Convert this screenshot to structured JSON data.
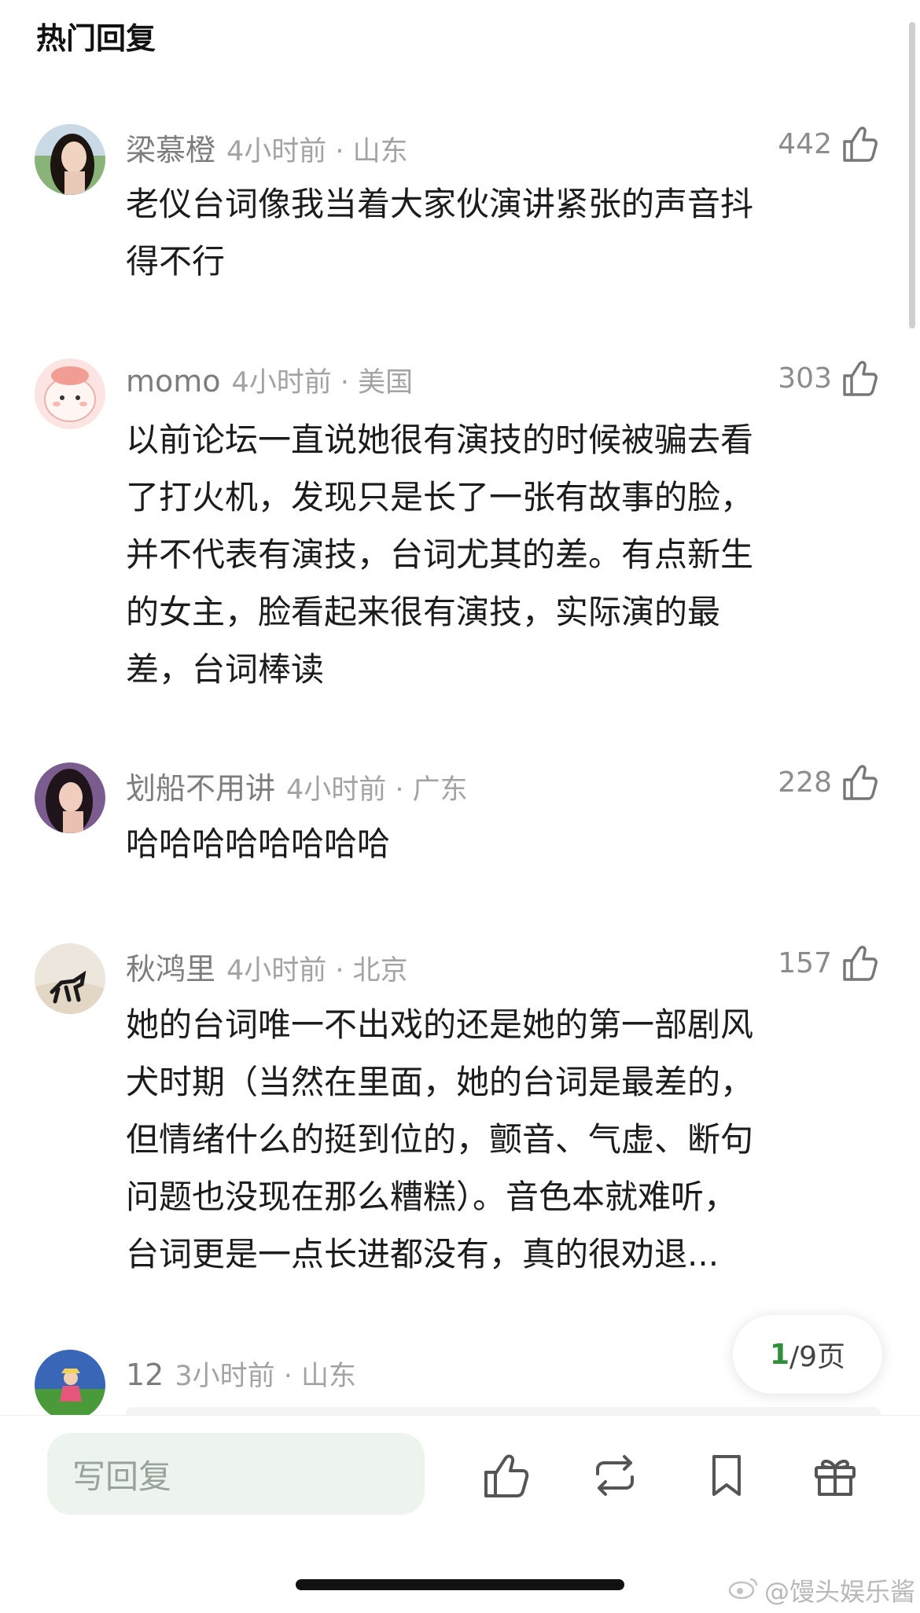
{
  "header": {
    "title": "热门回复"
  },
  "comments": [
    {
      "user": "梁慕橙",
      "time": "4小时前 · 山东",
      "likes": "442",
      "text": [
        "老仪台词像我当着大家伙演讲紧张的声音抖",
        "得不行"
      ]
    },
    {
      "user": "momo",
      "time": "4小时前 · 美国",
      "likes": "303",
      "text": [
        "以前论坛一直说她很有演技的时候被骗去看",
        "了打火机，发现只是长了一张有故事的脸，",
        "并不代表有演技，台词尤其的差。有点新生",
        "的女主，脸看起来很有演技，实际演的最",
        "差，台词棒读"
      ]
    },
    {
      "user": "划船不用讲",
      "time": "4小时前 · 广东",
      "likes": "228",
      "text": [
        "哈哈哈哈哈哈哈哈"
      ]
    },
    {
      "user": "秋鸿里",
      "time": "4小时前 · 北京",
      "likes": "157",
      "text": [
        "她的台词唯一不出戏的还是她的第一部剧风",
        "犬时期（当然在里面，她的台词是最差的，",
        "但情绪什么的挺到位的，颤音、气虚、断句",
        "问题也没现在那么糟糕）。音色本就难听，",
        "台词更是一点长进都没有，真的很劝退..."
      ]
    },
    {
      "user": "12",
      "time": "3小时前 · 山东",
      "likes": "",
      "text": []
    }
  ],
  "pager": {
    "current": "1",
    "total": "/9页"
  },
  "bottom_bar": {
    "reply_placeholder": "写回复",
    "actions": [
      "like-icon",
      "repost-icon",
      "bookmark-icon",
      "gift-icon"
    ]
  },
  "watermark": "@馒头娱乐酱",
  "colors": {
    "accent": "#2f8f3a",
    "input_bg": "#edf4ee",
    "meta": "#8c8c8c"
  }
}
